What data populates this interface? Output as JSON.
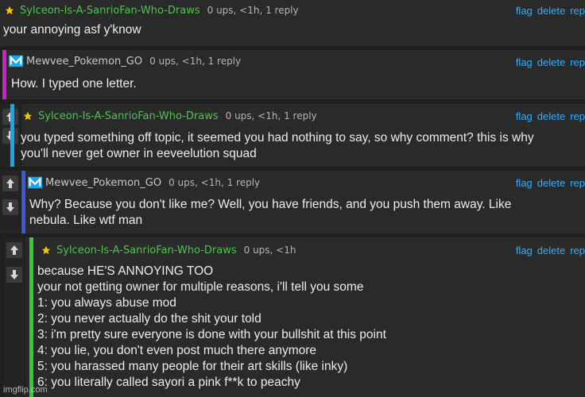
{
  "colors": {
    "green": "#4ec44e",
    "magenta": "#cc22cc",
    "cyan": "#1aa7ea",
    "blue": "#3f55e0",
    "lime": "#33cc33",
    "link": "#2fb0ff"
  },
  "comments": [
    {
      "user": "Sylceon-Is-A-SanrioFan-Who-Draws",
      "meta": "0 ups, <1h, 1 reply",
      "actions": {
        "flag": "flag",
        "delete": "delete",
        "reply": "rep"
      },
      "lines": [
        "your annoying asf y'know"
      ]
    },
    {
      "user": "Mewvee_Pokemon_GO",
      "meta": "0 ups, <1h, 1 reply",
      "actions": {
        "flag": "flag",
        "delete": "delete",
        "reply": "rep"
      },
      "lines": [
        "How. I typed one letter."
      ]
    },
    {
      "user": "Sylceon-Is-A-SanrioFan-Who-Draws",
      "meta": "0 ups, <1h, 1 reply",
      "actions": {
        "flag": "flag",
        "delete": "delete",
        "reply": "rep"
      },
      "lines": [
        "you typed something off topic, it seemed you had nothing to say, so why comment? this is why",
        "you'll never get owner in eeveelution squad"
      ]
    },
    {
      "user": "Mewvee_Pokemon_GO",
      "meta": "0 ups, <1h, 1 reply",
      "actions": {
        "flag": "flag",
        "delete": "delete",
        "reply": "rep"
      },
      "lines": [
        "Why? Because you don't like me? Well, you have friends, and you push them away. Like",
        "nebula. Like wtf man"
      ]
    },
    {
      "user": "Sylceon-Is-A-SanrioFan-Who-Draws",
      "meta": "0 ups, <1h",
      "actions": {
        "flag": "flag",
        "delete": "delete",
        "reply": "rep"
      },
      "lines": [
        "because HE'S ANNOYING TOO",
        "your not getting owner for multiple reasons, i'll tell you some",
        "1: you always abuse mod",
        "2: you never actually do the shit your told",
        "3: i'm pretty sure everyone is done with your bullshit at this point",
        "4: you lie, you don't even post much there anymore",
        "5: you harassed many people for their art skills (like inky)",
        "6: you literally called sayori a pink f**k to peachy"
      ]
    }
  ],
  "watermark": "imgflip.com"
}
